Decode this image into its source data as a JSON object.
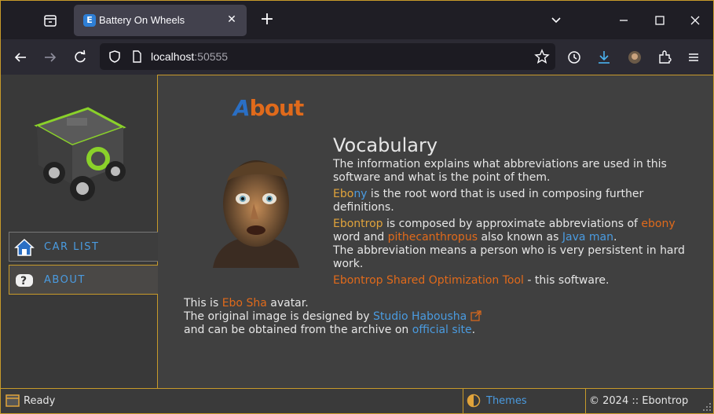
{
  "browser": {
    "tab_title": "Battery On Wheels",
    "url_host": "localhost",
    "url_port": ":50555"
  },
  "sidebar": {
    "items": [
      {
        "label": "CAR LIST",
        "icon": "home-icon"
      },
      {
        "label": "ABOUT",
        "icon": "question-icon"
      }
    ]
  },
  "about": {
    "title_first": "A",
    "title_rest": "bout",
    "vocab_heading": "Vocabulary",
    "intro": "The information explains what abbreviations are used in this software and what is the point of them.",
    "ebony": {
      "hl1": "Ebo",
      "hl2": "ny",
      "text": " is the root word that is used in composing further definitions."
    },
    "ebontrop": {
      "term": "Ebontrop",
      "t1": " is composed by approximate abbreviations of ",
      "w1": "ebony",
      "t2": " word and ",
      "w2": "pithecanthropus",
      "t3": " also known as ",
      "w3": "Java man",
      "t4": ".",
      "t5": "The abbreviation means a person who is very persistent in hard work."
    },
    "tool": {
      "term": "Ebontrop Shared Optimization Tool",
      "text": " - this software."
    },
    "credits": {
      "l1a": "This is ",
      "l1b": "Ebo Sha",
      "l1c": " avatar.",
      "l2a": "The original image is designed by ",
      "l2b": "Studio Habousha",
      "l3a": "and can be obtained from the archive on ",
      "l3b": "official site",
      "l3c": "."
    }
  },
  "status": {
    "ready": "Ready",
    "themes": "Themes",
    "copyright": "© 2024 :: Ebontrop"
  },
  "colors": {
    "accent": "#c79a2a",
    "link": "#4a9be0",
    "highlight": "#e06a1b",
    "yellow": "#e0a33b"
  }
}
